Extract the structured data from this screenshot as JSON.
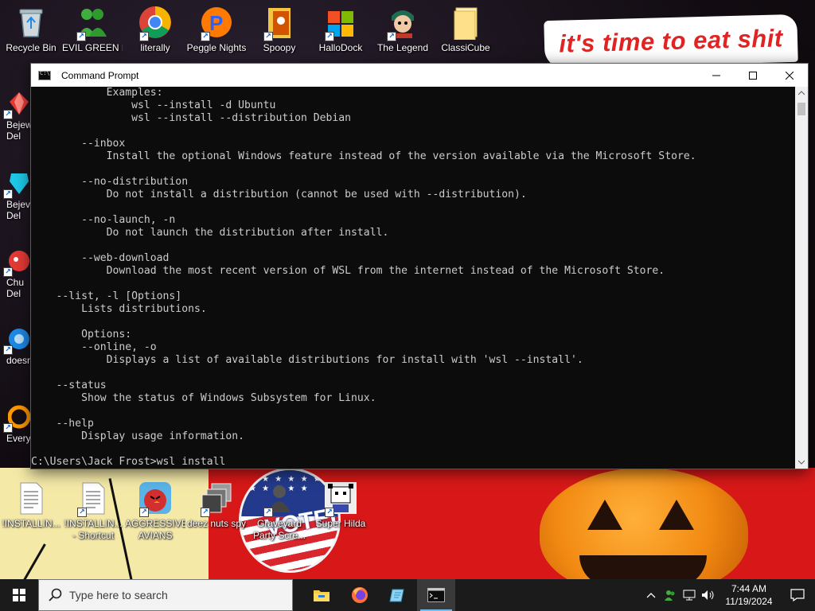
{
  "wallpaper": {
    "meme_text": "it's time to eat shit",
    "sticker_text": "VOTED"
  },
  "desktop_top_icons": [
    {
      "label": "Recycle Bin",
      "icon": "recycle-bin-icon"
    },
    {
      "label": "EVIL GREEN MEN CO",
      "icon": "green-men-icon"
    },
    {
      "label": "literally",
      "icon": "chrome-icon"
    },
    {
      "label": "Peggle Nights",
      "icon": "peggle-icon"
    },
    {
      "label": "Spoopy",
      "icon": "spoopy-folder-icon"
    },
    {
      "label": "HalloDock",
      "icon": "windows-logo-icon"
    },
    {
      "label": "The Legend",
      "icon": "legend-character-icon"
    },
    {
      "label": "ClassiCube",
      "icon": "folder-icon"
    }
  ],
  "desktop_side_icons": [
    {
      "label": "Bejew",
      "label2": "Del",
      "icon": "bejeweled-icon"
    },
    {
      "label": "Bejev",
      "label2": "Del",
      "icon": "bejeweled-gem-icon"
    },
    {
      "label": "Chu",
      "label2": "Del",
      "icon": "chuzzle-icon"
    },
    {
      "label": "doesn",
      "label2": "",
      "icon": "blue-app-icon"
    },
    {
      "label": "Every",
      "label2": "",
      "icon": "orange-app-icon"
    }
  ],
  "desktop_bottom_icons": [
    {
      "label": "!INSTALLIN...",
      "label2": "",
      "icon": "text-document-icon"
    },
    {
      "label": "!INSTALLIN...",
      "label2": "- Shortcut",
      "icon": "text-document-shortcut-icon"
    },
    {
      "label": "AGGRESSIVE",
      "label2": "AVIANS",
      "icon": "angry-bird-icon"
    },
    {
      "label": "deez nuts spy",
      "label2": "",
      "icon": "stacked-windows-icon"
    },
    {
      "label": "Graveyard",
      "label2": "Party Scre...",
      "icon": "graveyard-icon"
    },
    {
      "label": "Super Hilda",
      "label2": "",
      "icon": "pixel-character-icon"
    }
  ],
  "window": {
    "title": "Command Prompt",
    "console_lines": [
      "            Examples:",
      "                wsl --install -d Ubuntu",
      "                wsl --install --distribution Debian",
      "",
      "        --inbox",
      "            Install the optional Windows feature instead of the version available via the Microsoft Store.",
      "",
      "        --no-distribution",
      "            Do not install a distribution (cannot be used with --distribution).",
      "",
      "        --no-launch, -n",
      "            Do not launch the distribution after install.",
      "",
      "        --web-download",
      "            Download the most recent version of WSL from the internet instead of the Microsoft Store.",
      "",
      "    --list, -l [Options]",
      "        Lists distributions.",
      "",
      "        Options:",
      "        --online, -o",
      "            Displays a list of available distributions for install with 'wsl --install'.",
      "",
      "    --status",
      "        Show the status of Windows Subsystem for Linux.",
      "",
      "    --help",
      "        Display usage information.",
      "",
      "C:\\Users\\Jack Frost>wsl install"
    ]
  },
  "taskbar": {
    "search_placeholder": "Type here to search",
    "apps": [
      "file-explorer-icon",
      "firefox-icon",
      "notepad-icon",
      "command-prompt-icon"
    ],
    "time": "7:44 AM",
    "date": "11/19/2024"
  }
}
